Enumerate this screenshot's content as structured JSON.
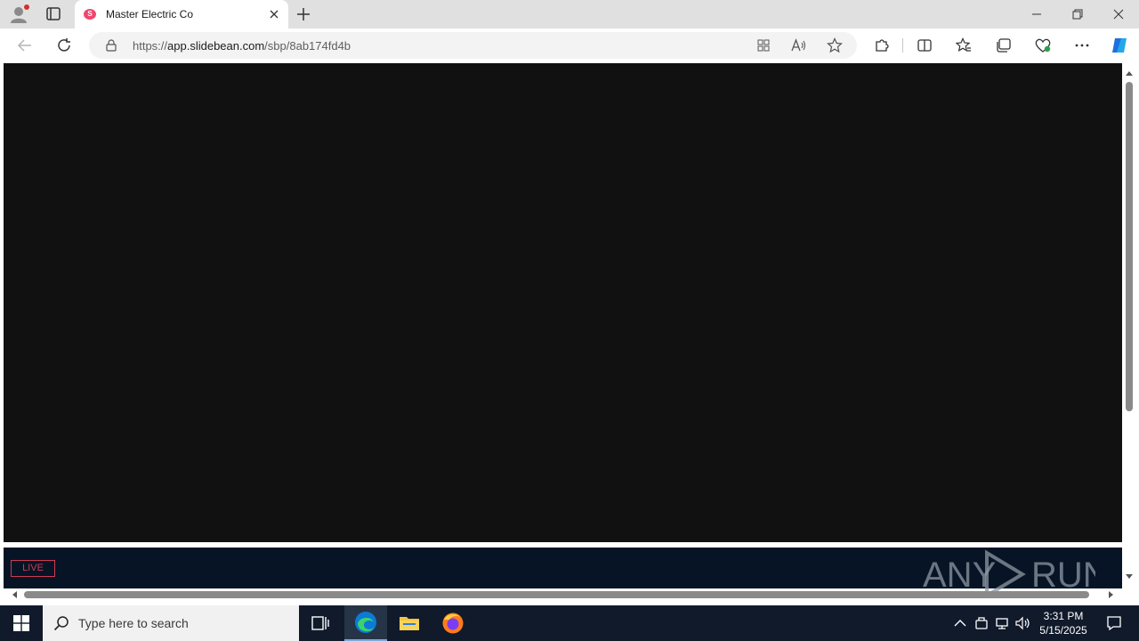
{
  "browser": {
    "tab": {
      "title": "Master Electric Co",
      "favicon_letter": "S"
    },
    "address": {
      "scheme": "https://",
      "host": "app.slidebean.com",
      "path": "/sbp/8ab174fd4b"
    }
  },
  "content": {
    "live_label": "LIVE",
    "watermark": {
      "text_left": "ANY",
      "text_right": "RUN"
    }
  },
  "taskbar": {
    "search_placeholder": "Type here to search",
    "clock_time": "3:31 PM",
    "clock_date": "5/15/2025"
  },
  "colors": {
    "slide_bg": "#111111",
    "strip_bg": "#071425",
    "live_accent": "#d03a55",
    "taskbar_bg": "#101a2b"
  }
}
